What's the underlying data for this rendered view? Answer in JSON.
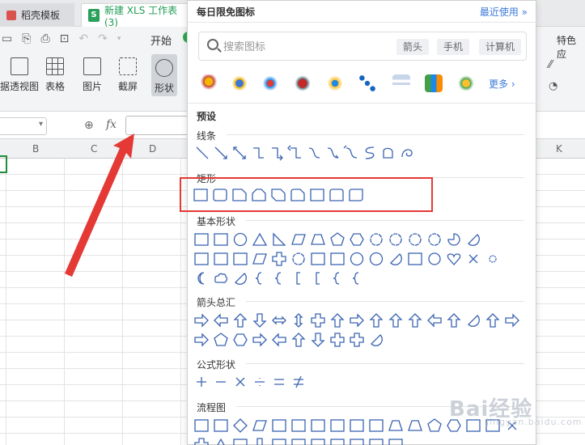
{
  "tabs": {
    "tab1": "稻壳模板",
    "tab2": "新建 XLS 工作表 (3)",
    "xls_badge": "S"
  },
  "toolbar": {
    "start": "开始",
    "pivot": "据透视图",
    "table": "表格",
    "picture": "图片",
    "screenshot": "截屏",
    "shape": "形状",
    "features": "特色应"
  },
  "formula": {
    "fx": "fx"
  },
  "columns": [
    "B",
    "C",
    "D",
    "K"
  ],
  "panel": {
    "title": "每日限免图标",
    "recent": "最近使用",
    "search_placeholder": "搜索图标",
    "chips": [
      "箭头",
      "手机",
      "计算机"
    ],
    "more": "更多",
    "preset": "预设",
    "sections": [
      "线条",
      "矩形",
      "基本形状",
      "箭头总汇",
      "公式形状",
      "流程图"
    ]
  },
  "colors": {
    "accent": "#3c78d8",
    "shape_stroke": "#3a63b0",
    "highlight": "#e53935",
    "green": "#2ea94f"
  },
  "watermark": "Bai经验",
  "watermark_sub": "jingyan.baidu.com"
}
